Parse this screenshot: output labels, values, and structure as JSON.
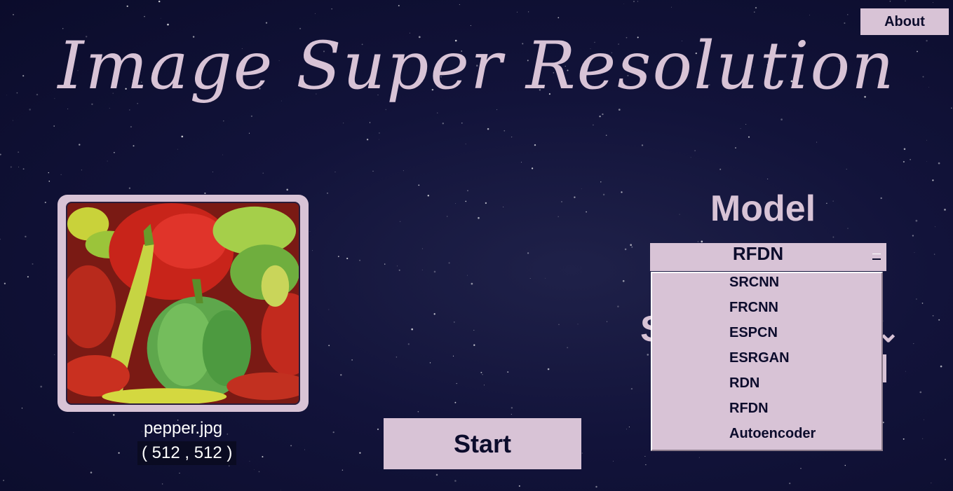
{
  "app": {
    "title": "Image Super Resolution"
  },
  "header": {
    "about_label": "About"
  },
  "image_panel": {
    "filename": "pepper.jpg",
    "dimensions": "( 512 , 512 )"
  },
  "controls": {
    "start_label": "Start",
    "model_heading": "Model",
    "selected_model": "RFDN",
    "model_options": [
      "SRCNN",
      "FRCNN",
      "ESPCN",
      "ESRGAN",
      "RDN",
      "RFDN",
      "Autoencoder"
    ]
  },
  "colors": {
    "accent": "#d8c3d6",
    "background": "#0c0d2d",
    "text_dark": "#0c0c2c"
  }
}
